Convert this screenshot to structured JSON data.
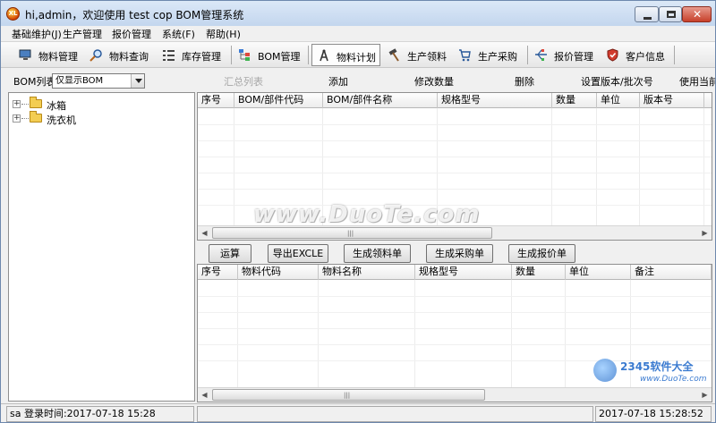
{
  "window": {
    "title": "hi,admin，欢迎使用 test cop BOM管理系统",
    "app_icon_text": "XL"
  },
  "menu": [
    "基础维护(J)",
    "生产管理",
    "报价管理",
    "系统(F)",
    "帮助(H)"
  ],
  "toolbar": [
    "物料管理",
    "物料查询",
    "库存管理",
    "BOM管理",
    "物料计划",
    "生产领料",
    "生产采购",
    "报价管理",
    "客户信息"
  ],
  "actionbar": {
    "bom_label": "BOM列表",
    "bom_select": "仅显示BOM",
    "actions": [
      "汇总列表",
      "添加",
      "修改数量",
      "删除",
      "设置版本/批次号",
      "使用当前"
    ]
  },
  "tree": [
    "冰箱",
    "洗衣机"
  ],
  "grid_top": {
    "columns": [
      "序号",
      "BOM/部件代码",
      "BOM/部件名称",
      "规格型号",
      "数量",
      "单位",
      "版本号"
    ]
  },
  "buttons": [
    "运算",
    "导出EXCLE",
    "生成领料单",
    "生成采购单",
    "生成报价单"
  ],
  "grid_bottom": {
    "columns": [
      "序号",
      "物料代码",
      "物料名称",
      "规格型号",
      "数量",
      "单位",
      "备注"
    ]
  },
  "status": {
    "left": "sa 登录时间:2017-07-18 15:28",
    "right": "2017-07-18 15:28:52"
  },
  "watermark": "www.DuoTe.com",
  "corner_logo": {
    "brand": "2345软件大全",
    "url": "www.DuoTe.com"
  }
}
